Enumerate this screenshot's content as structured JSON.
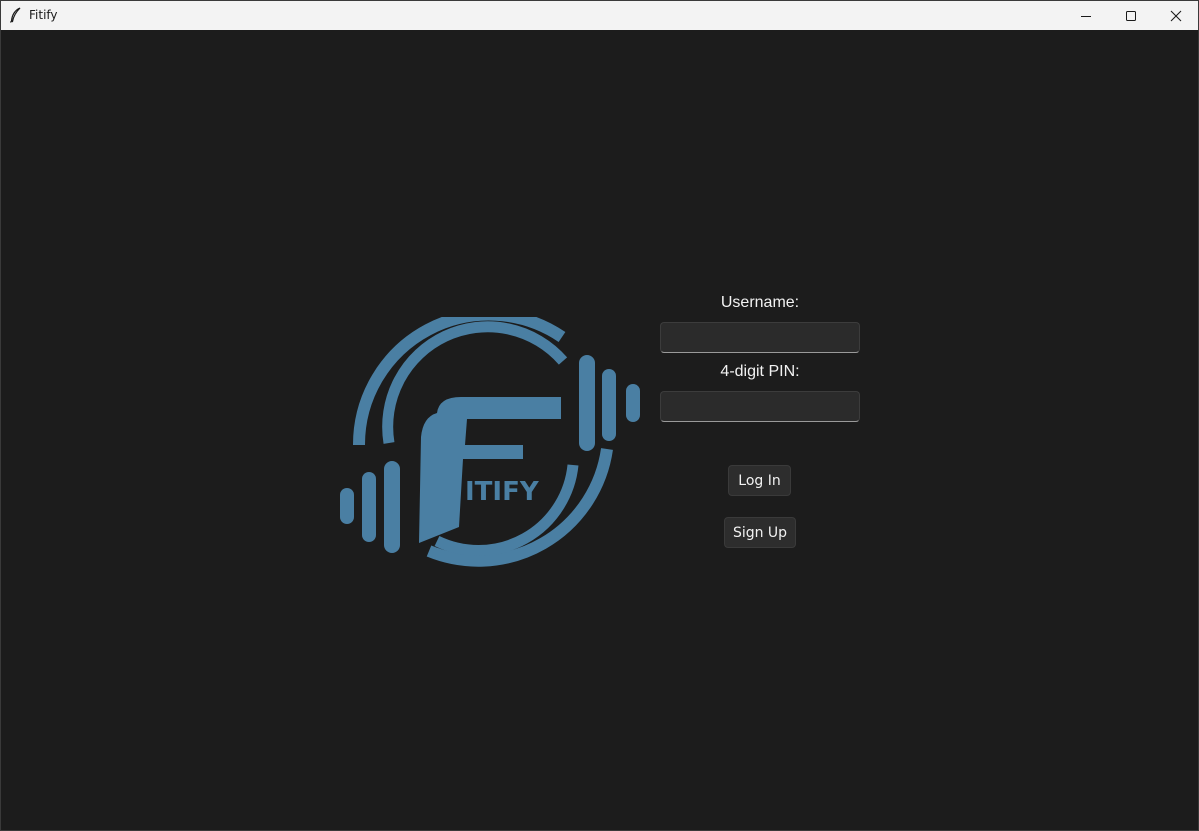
{
  "window": {
    "title": "Fitify",
    "icon": "feather-icon",
    "controls": [
      "minimize-icon",
      "maximize-icon",
      "close-icon"
    ]
  },
  "logo": {
    "text": "ITIFY",
    "letter": "F",
    "color": "#4a7fa3"
  },
  "form": {
    "username_label": "Username:",
    "username_value": "",
    "pin_label": "4-digit PIN:",
    "pin_value": "",
    "login_label": "Log In",
    "signup_label": "Sign Up"
  },
  "colors": {
    "background": "#1c1c1c",
    "titlebar": "#f3f3f3",
    "field": "#2b2b2b",
    "button": "#2d2d2d",
    "text": "#f2f2f2"
  }
}
